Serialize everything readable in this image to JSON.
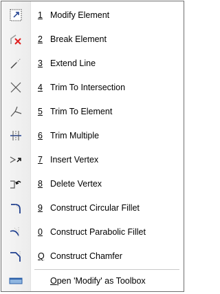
{
  "menu": {
    "items": [
      {
        "key": "1",
        "label": "Modify Element",
        "icon": "modify-element-icon"
      },
      {
        "key": "2",
        "label": "Break Element",
        "icon": "break-element-icon"
      },
      {
        "key": "3",
        "label": "Extend Line",
        "icon": "extend-line-icon"
      },
      {
        "key": "4",
        "label": "Trim To Intersection",
        "icon": "trim-to-intersection-icon"
      },
      {
        "key": "5",
        "label": "Trim To Element",
        "icon": "trim-to-element-icon"
      },
      {
        "key": "6",
        "label": "Trim Multiple",
        "icon": "trim-multiple-icon"
      },
      {
        "key": "7",
        "label": "Insert Vertex",
        "icon": "insert-vertex-icon"
      },
      {
        "key": "8",
        "label": "Delete Vertex",
        "icon": "delete-vertex-icon"
      },
      {
        "key": "9",
        "label": "Construct Circular Fillet",
        "icon": "circular-fillet-icon"
      },
      {
        "key": "0",
        "label": "Construct Parabolic Fillet",
        "icon": "parabolic-fillet-icon"
      },
      {
        "key": "Q",
        "label": "Construct Chamfer",
        "icon": "chamfer-icon"
      }
    ],
    "toolbox": {
      "label_prefix": "O",
      "label_rest": "pen 'Modify' as Toolbox",
      "icon": "toolbox-icon"
    }
  },
  "colors": {
    "accent": "#1f3f8f",
    "error": "#e02020",
    "line": "#9a9a9a"
  }
}
